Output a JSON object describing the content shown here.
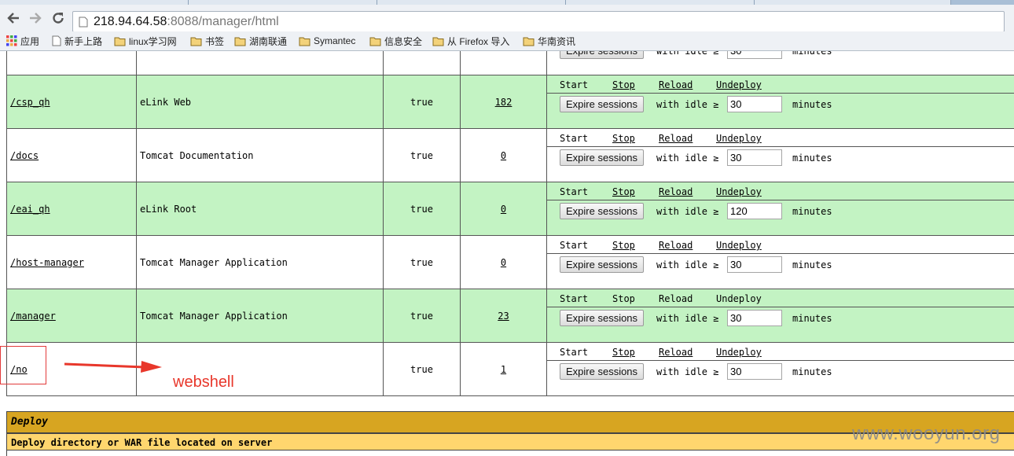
{
  "browser": {
    "url_host": "218.94.64.58",
    "url_rest": ":8088/manager/html",
    "bookmarks": [
      {
        "label": "应用",
        "icon": "apps-grid-icon"
      },
      {
        "label": "新手上路",
        "icon": "page-icon"
      },
      {
        "label": "linux学习网",
        "icon": "folder-icon"
      },
      {
        "label": "书签",
        "icon": "folder-icon"
      },
      {
        "label": "湖南联通",
        "icon": "folder-icon"
      },
      {
        "label": "Symantec",
        "icon": "folder-icon"
      },
      {
        "label": "信息安全",
        "icon": "folder-icon"
      },
      {
        "label": "从 Firefox 导入",
        "icon": "folder-icon"
      },
      {
        "label": "华南资讯",
        "icon": "folder-icon"
      }
    ]
  },
  "labels": {
    "start": "Start",
    "stop": "Stop",
    "reload": "Reload",
    "undeploy": "Undeploy",
    "expire": "Expire sessions",
    "with_idle": "with idle ≥",
    "minutes": "minutes"
  },
  "applications": [
    {
      "path": "",
      "display_name": "",
      "running": "",
      "sessions": "",
      "idle": "30",
      "start_link": false,
      "stop_link": true,
      "reload_link": true,
      "undeploy_link": true
    },
    {
      "path": "/csp_qh",
      "display_name": "eLink Web",
      "running": "true",
      "sessions": "182",
      "idle": "30",
      "start_link": false,
      "stop_link": true,
      "reload_link": true,
      "undeploy_link": true
    },
    {
      "path": "/docs",
      "display_name": "Tomcat Documentation",
      "running": "true",
      "sessions": "0",
      "idle": "30",
      "start_link": false,
      "stop_link": true,
      "reload_link": true,
      "undeploy_link": true
    },
    {
      "path": "/eai_qh",
      "display_name": "eLink Root",
      "running": "true",
      "sessions": "0",
      "idle": "120",
      "start_link": false,
      "stop_link": true,
      "reload_link": true,
      "undeploy_link": true
    },
    {
      "path": "/host-manager",
      "display_name": "Tomcat Manager Application",
      "running": "true",
      "sessions": "0",
      "idle": "30",
      "start_link": false,
      "stop_link": true,
      "reload_link": true,
      "undeploy_link": true
    },
    {
      "path": "/manager",
      "display_name": "Tomcat Manager Application",
      "running": "true",
      "sessions": "23",
      "idle": "30",
      "start_link": false,
      "stop_link": false,
      "reload_link": false,
      "undeploy_link": false
    },
    {
      "path": "/no",
      "display_name": "",
      "running": "true",
      "sessions": "1",
      "idle": "30",
      "start_link": false,
      "stop_link": true,
      "reload_link": true,
      "undeploy_link": true
    }
  ],
  "deploy": {
    "title": "Deploy",
    "subtitle": "Deploy directory or WAR file located on server"
  },
  "annotation": {
    "label": "webshell",
    "color": "#e8372b"
  },
  "watermark": "www.wooyun.org"
}
